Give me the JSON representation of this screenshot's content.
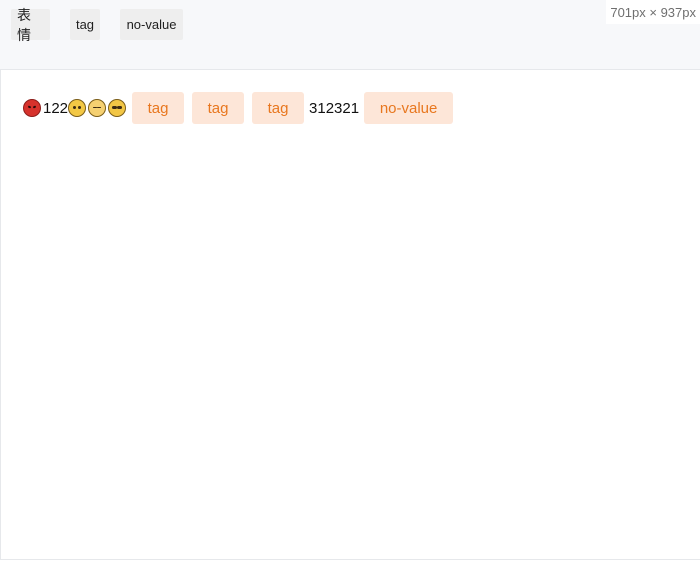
{
  "toolbar": {
    "buttons": [
      {
        "label": "表情"
      },
      {
        "label": "tag"
      },
      {
        "label": "no-value"
      }
    ],
    "size_readout": "701px × 937px"
  },
  "editor": {
    "line": {
      "text_before": "122",
      "text_between": "312321",
      "chips": [
        {
          "label": "tag"
        },
        {
          "label": "tag"
        },
        {
          "label": "tag"
        },
        {
          "label": "no-value"
        }
      ],
      "emojis": [
        "angry-face-emoji",
        "grinning-squinting-face-emoji",
        "smirking-face-emoji",
        "cool-face-emoji"
      ]
    }
  },
  "colors": {
    "chip_bg": "#fde6d8",
    "chip_text": "#e8771f",
    "toolbar_bg": "#f7f8fa",
    "button_bg": "#eeeeee",
    "border": "#e6e8eb"
  }
}
